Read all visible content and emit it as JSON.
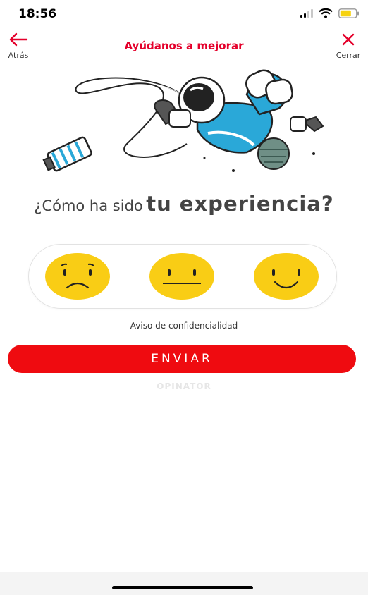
{
  "status_bar": {
    "time": "18:56",
    "icons": [
      "signal-icon",
      "wifi-icon",
      "battery-icon"
    ]
  },
  "header": {
    "back_label": "Atrás",
    "title": "Ayúdanos a mejorar",
    "close_label": "Cerrar"
  },
  "question": {
    "prefix": "¿Cómo ha sido",
    "emphasis": "tu experiencia?"
  },
  "rating": {
    "options": [
      "sad-face-icon",
      "neutral-face-icon",
      "happy-face-icon"
    ]
  },
  "privacy_link": "Aviso de confidencialidad",
  "submit_label": "ENVIAR",
  "brand": "OPINATOR",
  "colors": {
    "accent": "#e4002b",
    "button": "#ef0b10",
    "face": "#f9cd15",
    "astronaut_blue": "#2aa8d8"
  }
}
